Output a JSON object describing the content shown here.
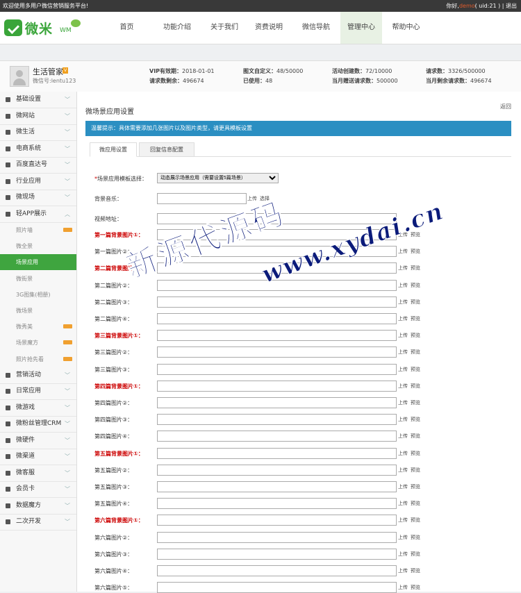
{
  "topbar": {
    "welcome": "欢迎使用多用户微信营销服务平台!",
    "greeting": "你好,",
    "username": "demo",
    "uid": "( uid:21 )",
    "logout": "退出"
  },
  "logo": {
    "text": "微米",
    "sub": "WM"
  },
  "nav": {
    "items": [
      "首页",
      "功能介绍",
      "关于我们",
      "资费说明",
      "微信导航",
      "管理中心",
      "帮助中心"
    ],
    "active": "管理中心"
  },
  "profile": {
    "name": "生活管家",
    "vip_badge": "V",
    "wechat_id": "微信号:lentu123",
    "stats": [
      {
        "label": "VIP有效期：",
        "value": "2018-01-01"
      },
      {
        "label": "请求数剩余：",
        "value": "496674"
      },
      {
        "label": "图文自定义：",
        "value": "48/50000"
      },
      {
        "label": "已使用：",
        "value": "48"
      },
      {
        "label": "活动创建数：",
        "value": "72/10000"
      },
      {
        "label": "当月赠送请求数：",
        "value": "500000"
      },
      {
        "label": "请求数：",
        "value": "3326/500000"
      },
      {
        "label": "当月剩余请求数：",
        "value": "496674"
      }
    ]
  },
  "sidebar": {
    "top": [
      "基础设置",
      "微网站",
      "微生活",
      "电商系统",
      "百度直达号",
      "行业应用",
      "微现场",
      "轻APP展示"
    ],
    "sub": [
      "照片墙",
      "微全景",
      "场景应用",
      "微街景",
      "3G图集(相册)",
      "微场景",
      "微秀美",
      "场景魔方",
      "照片抢先看"
    ],
    "bottom": [
      "营销活动",
      "日常应用",
      "微游戏",
      "微粉丝管理CRM",
      "微硬件",
      "微渠道",
      "微客服",
      "会员卡",
      "数据魔方",
      "二次开发"
    ]
  },
  "main": {
    "title": "微场景应用设置",
    "back": "返回",
    "alert": "温馨提示：具体需要添加几张图片以及图片类型，请更具模板设置",
    "tabs": [
      "微应用设置",
      "回复信息配置"
    ],
    "template_label": "场景应用模板选择：",
    "template_value": "动态展示场景应用（需要设置5篇场景）",
    "music_label": "背景音乐：",
    "video_label": "视频地址：",
    "upload": "上传",
    "choose": "选择",
    "preview": "预览",
    "image_rows": [
      "第一篇背景图片①：",
      "第一篇图片②：",
      "第二篇背景图片①：",
      "第二篇图片②：",
      "第二篇图片③：",
      "第二篇图片④：",
      "第三篇背景图片①：",
      "第三篇图片②：",
      "第三篇图片③：",
      "第四篇背景图片①：",
      "第四篇图片②：",
      "第四篇图片③：",
      "第四篇图片④：",
      "第五篇背景图片①：",
      "第五篇图片②：",
      "第五篇图片③：",
      "第五篇图片④：",
      "第六篇背景图片①：",
      "第六篇图片②：",
      "第六篇图片③：",
      "第六篇图片④：",
      "第六篇图片⑤："
    ]
  },
  "watermark": {
    "text": "新源代源码",
    "url": "www.xydai.cn"
  }
}
